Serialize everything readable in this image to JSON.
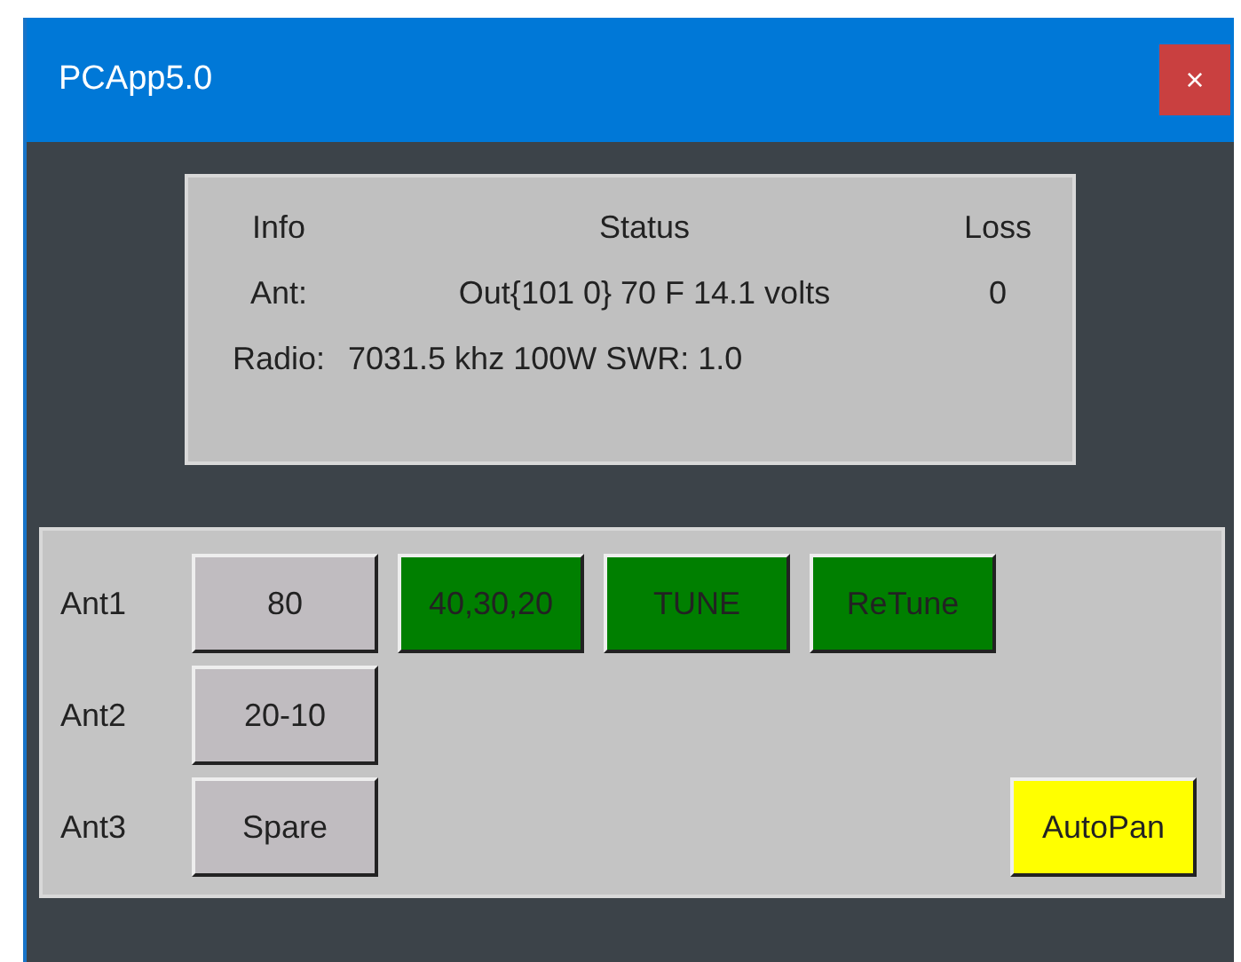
{
  "window": {
    "title": "PCApp5.0",
    "close": "×"
  },
  "info_table": {
    "columns": [
      "Info",
      "Status",
      "Loss"
    ],
    "rows": [
      {
        "cells": [
          "Ant:",
          "Out{101 0} 70 F 14.1 volts",
          "0"
        ]
      },
      {
        "cells": [
          "Radio:",
          "7031.5 khz 100W  SWR: 1.0"
        ]
      }
    ]
  },
  "antennas": [
    {
      "label": "Ant1",
      "button": {
        "text": "80",
        "color": "#c0bcc0"
      }
    },
    {
      "label": "Ant2",
      "button": {
        "text": "20-10",
        "color": "#c0bcc0"
      }
    },
    {
      "label": "Ant3",
      "button": {
        "text": "Spare",
        "color": "#c0bcc0"
      }
    }
  ],
  "actions": [
    {
      "text": "40,30,20",
      "color": "#007f00"
    },
    {
      "text": "TUNE",
      "color": "#007f00"
    },
    {
      "text": "ReTune",
      "color": "#007f00"
    }
  ],
  "autopan": {
    "text": "AutoPan",
    "color": "#ffff00"
  }
}
